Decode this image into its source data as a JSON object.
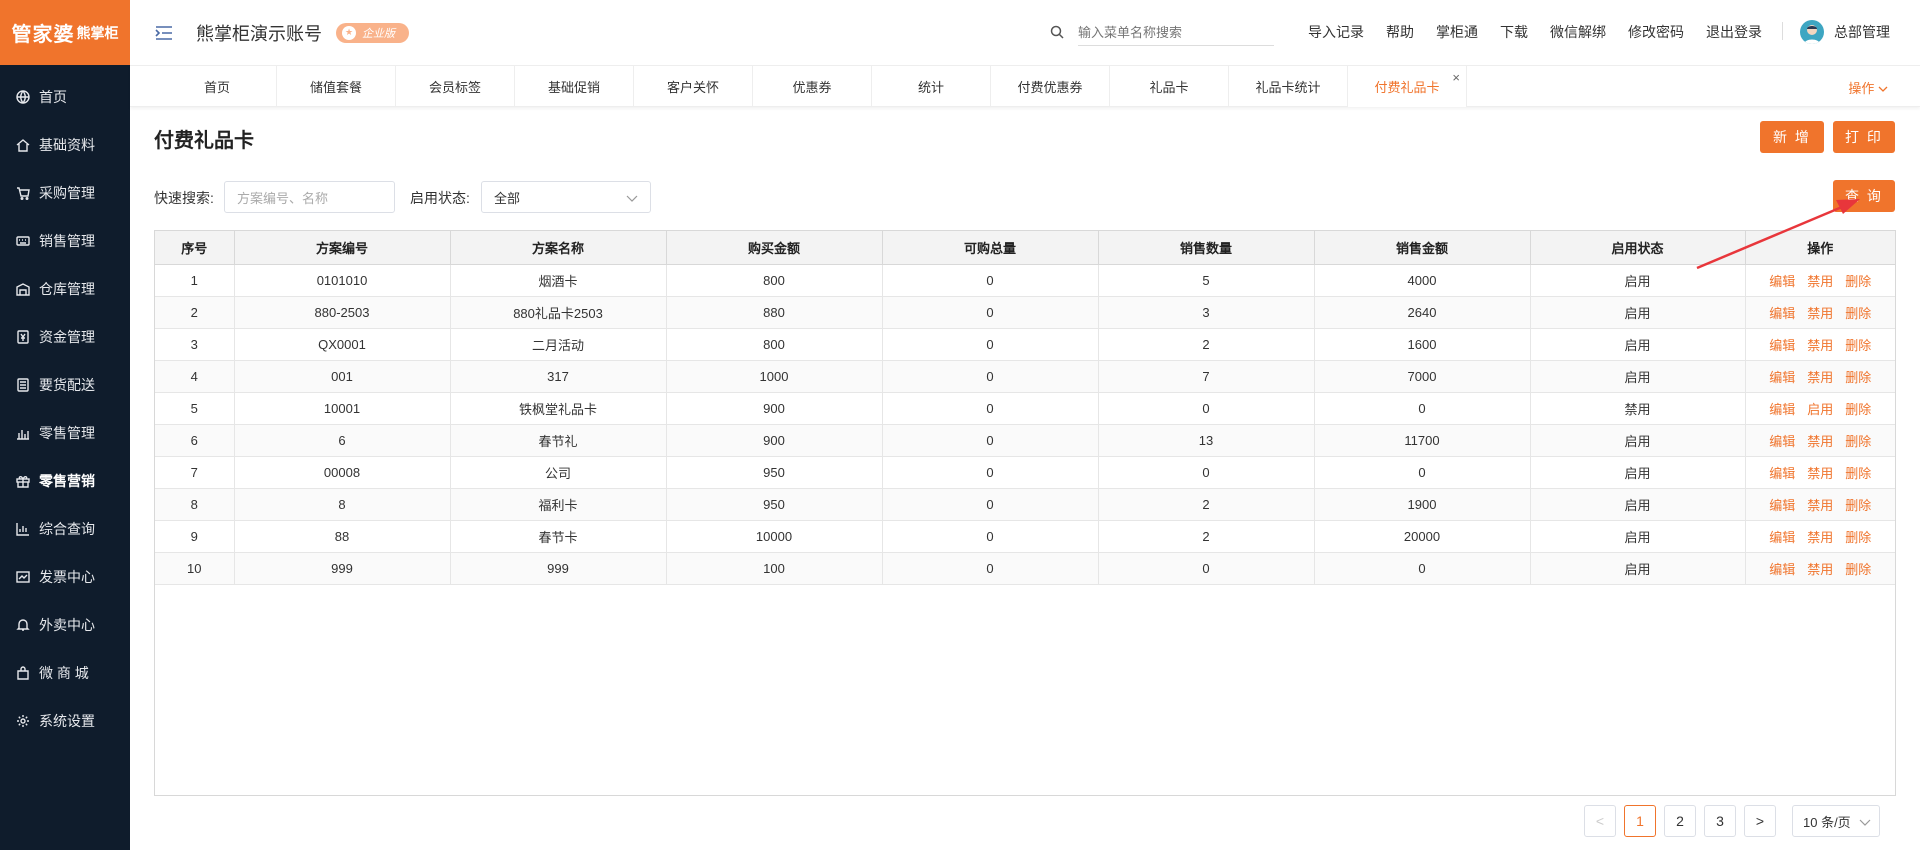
{
  "brand": {
    "main": "管家婆",
    "sub": "熊掌柜",
    "color": "#f0742c"
  },
  "sidebar": {
    "items": [
      {
        "label": "首页",
        "icon": "globe-icon"
      },
      {
        "label": "基础资料",
        "icon": "home-icon"
      },
      {
        "label": "采购管理",
        "icon": "cart-icon"
      },
      {
        "label": "销售管理",
        "icon": "keyboard-icon"
      },
      {
        "label": "仓库管理",
        "icon": "warehouse-icon"
      },
      {
        "label": "资金管理",
        "icon": "money-icon"
      },
      {
        "label": "要货配送",
        "icon": "list-icon"
      },
      {
        "label": "零售管理",
        "icon": "bar-chart-icon"
      },
      {
        "label": "零售营销",
        "icon": "gift-icon",
        "active": true
      },
      {
        "label": "综合查询",
        "icon": "chart-icon"
      },
      {
        "label": "发票中心",
        "icon": "trend-icon"
      },
      {
        "label": "外卖中心",
        "icon": "bell-icon"
      },
      {
        "label": "微 商 城",
        "icon": "bag-icon"
      },
      {
        "label": "系统设置",
        "icon": "gear-icon"
      }
    ]
  },
  "header": {
    "account_title": "熊掌柜演示账号",
    "edition": "企业版",
    "search_placeholder": "输入菜单名称搜索",
    "links": [
      "导入记录",
      "帮助",
      "掌柜通",
      "下载",
      "微信解绑",
      "修改密码",
      "退出登录"
    ],
    "user_name": "总部管理"
  },
  "tabs": {
    "items": [
      "首页",
      "储值套餐",
      "会员标签",
      "基础促销",
      "客户关怀",
      "优惠券",
      "统计",
      "付费优惠券",
      "礼品卡",
      "礼品卡统计",
      "付费礼品卡"
    ],
    "active_index": 10,
    "close_symbol": "×",
    "action_label": "操作"
  },
  "page": {
    "title": "付费礼品卡",
    "add_label": "新 增",
    "print_label": "打 印",
    "query_label": "查 询"
  },
  "filters": {
    "quick_search_label": "快速搜索:",
    "quick_search_placeholder": "方案编号、名称",
    "status_label": "启用状态:",
    "status_value": "全部"
  },
  "table": {
    "columns": [
      "序号",
      "方案编号",
      "方案名称",
      "购买金额",
      "可购总量",
      "销售数量",
      "销售金额",
      "启用状态",
      "操作"
    ],
    "rows": [
      [
        "1",
        "0101010",
        "烟酒卡",
        "800",
        "0",
        "5",
        "4000",
        "启用",
        "禁用"
      ],
      [
        "2",
        "880-2503",
        "880礼品卡2503",
        "880",
        "0",
        "3",
        "2640",
        "启用",
        "禁用"
      ],
      [
        "3",
        "QX0001",
        "二月活动",
        "800",
        "0",
        "2",
        "1600",
        "启用",
        "禁用"
      ],
      [
        "4",
        "001",
        "317",
        "1000",
        "0",
        "7",
        "7000",
        "启用",
        "禁用"
      ],
      [
        "5",
        "10001",
        "铁枫堂礼品卡",
        "900",
        "0",
        "0",
        "0",
        "禁用",
        "启用"
      ],
      [
        "6",
        "6",
        "春节礼",
        "900",
        "0",
        "13",
        "11700",
        "启用",
        "禁用"
      ],
      [
        "7",
        "00008",
        "公司",
        "950",
        "0",
        "0",
        "0",
        "启用",
        "禁用"
      ],
      [
        "8",
        "8",
        "福利卡",
        "950",
        "0",
        "2",
        "1900",
        "启用",
        "禁用"
      ],
      [
        "9",
        "88",
        "春节卡",
        "10000",
        "0",
        "2",
        "20000",
        "启用",
        "禁用"
      ],
      [
        "10",
        "999",
        "999",
        "100",
        "0",
        "0",
        "0",
        "启用",
        "禁用"
      ]
    ],
    "op_edit": "编辑",
    "op_delete": "删除"
  },
  "pagination": {
    "prev": "<",
    "pages": [
      "1",
      "2",
      "3"
    ],
    "current": "1",
    "next": ">",
    "page_size": "10 条/页"
  },
  "colors": {
    "accent": "#f0742c",
    "sidebar_bg": "#0f1c2c",
    "annotation_arrow": "#e8363b"
  }
}
